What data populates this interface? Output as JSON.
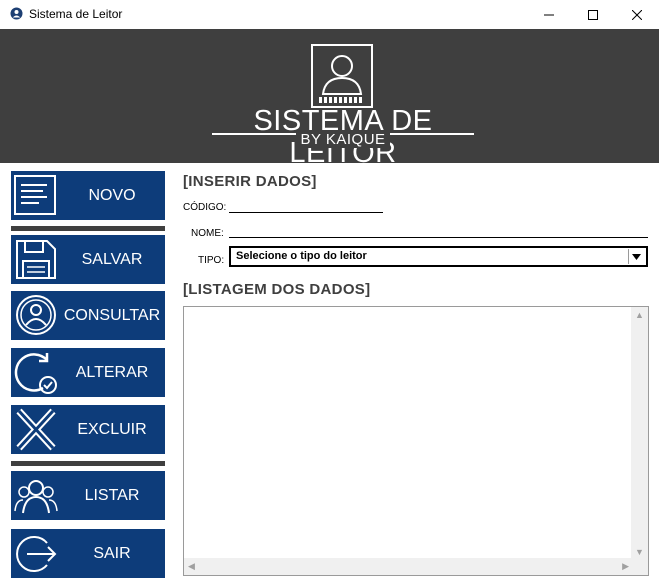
{
  "window": {
    "title": "Sistema de Leitor"
  },
  "banner": {
    "title": "SISTEMA DE LEITOR",
    "subtitle": "BY KAIQUE"
  },
  "sidebar": {
    "buttons": [
      {
        "label": "NOVO",
        "icon": "form-icon"
      },
      {
        "label": "SALVAR",
        "icon": "floppy-disk-icon"
      },
      {
        "label": "CONSULTAR",
        "icon": "user-search-icon"
      },
      {
        "label": "ALTERAR",
        "icon": "refresh-check-icon"
      },
      {
        "label": "EXCLUIR",
        "icon": "cross-icon"
      },
      {
        "label": "LISTAR",
        "icon": "users-icon"
      },
      {
        "label": "SAIR",
        "icon": "exit-icon"
      }
    ]
  },
  "form": {
    "section_insert": "[INSERIR DADOS]",
    "codigo_label": "CÓDIGO:",
    "codigo_value": "",
    "nome_label": "NOME:",
    "nome_value": "",
    "tipo_label": "TIPO:",
    "tipo_selected": "Selecione o tipo do leitor"
  },
  "list": {
    "section_title": "[LISTAGEM DOS DADOS]",
    "items": []
  },
  "colors": {
    "banner_bg": "#3f3f3f",
    "button_bg": "#0d3c7a",
    "separator": "#3f3f3f"
  }
}
